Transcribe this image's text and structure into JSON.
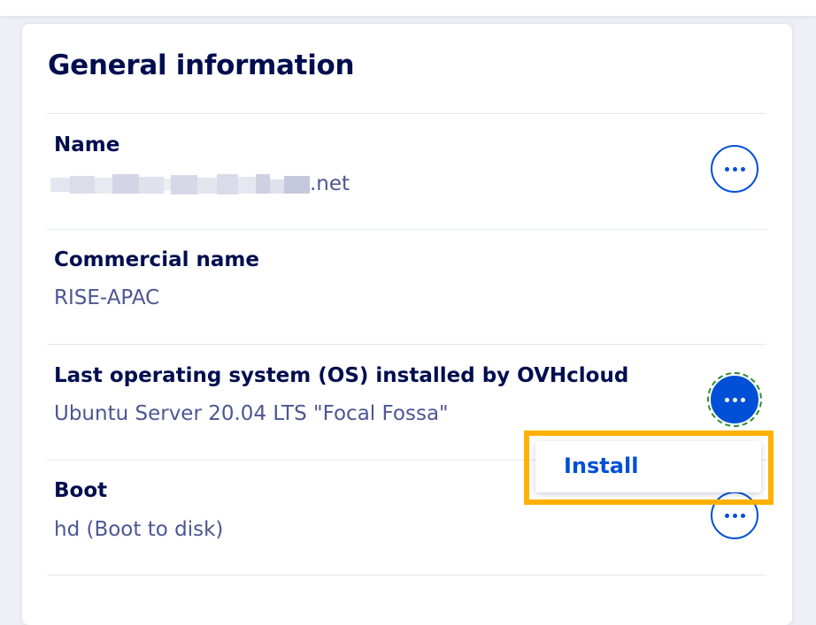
{
  "card": {
    "title": "General information"
  },
  "rows": [
    {
      "label": "Name",
      "value": ".net"
    },
    {
      "label": "Commercial name",
      "value": "RISE-APAC"
    },
    {
      "label": "Last operating system (OS) installed by OVHcloud",
      "value": "Ubuntu Server 20.04 LTS \"Focal Fossa\""
    },
    {
      "label": "Boot",
      "value": "hd (Boot to disk)"
    }
  ],
  "menu": {
    "install_label": "Install"
  },
  "colors": {
    "primary": "#0050d7",
    "heading": "#000e4f",
    "value_text": "#4d5693",
    "highlight": "#ffb000"
  },
  "icons": {
    "more": "ellipsis-icon"
  }
}
